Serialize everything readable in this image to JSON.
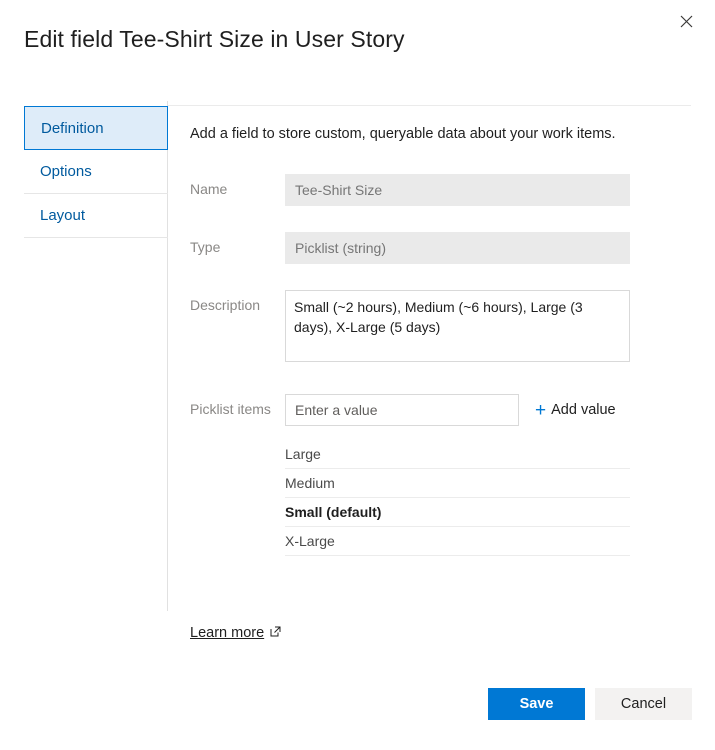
{
  "dialog": {
    "title": "Edit field Tee-Shirt Size in User Story",
    "close_icon": "close-icon",
    "accent_color": "#0078d4",
    "selected_tab_background": "#deecf9"
  },
  "tabs": [
    {
      "label": "Definition",
      "selected": true
    },
    {
      "label": "Options",
      "selected": false
    },
    {
      "label": "Layout",
      "selected": false
    }
  ],
  "definition": {
    "intro": "Add a field to store custom, queryable data about your work items.",
    "name": {
      "label": "Name",
      "value": "Tee-Shirt Size",
      "readonly": true
    },
    "type": {
      "label": "Type",
      "value": "Picklist (string)",
      "readonly": true
    },
    "description": {
      "label": "Description",
      "value": "Small (~2 hours), Medium (~6 hours), Large (3 days), X-Large (5 days)"
    },
    "picklist": {
      "label": "Picklist items",
      "input_value": "",
      "input_placeholder": "Enter a value",
      "add_button_label": "Add value",
      "add_button_icon": "plus-icon",
      "items": [
        {
          "label": "Large",
          "is_default": false
        },
        {
          "label": "Medium",
          "is_default": false
        },
        {
          "label": "Small (default)",
          "is_default": true
        },
        {
          "label": "X-Large",
          "is_default": false
        }
      ]
    },
    "learn_more": {
      "label": "Learn more",
      "icon": "external-link-icon"
    }
  },
  "footer": {
    "save_label": "Save",
    "cancel_label": "Cancel"
  }
}
